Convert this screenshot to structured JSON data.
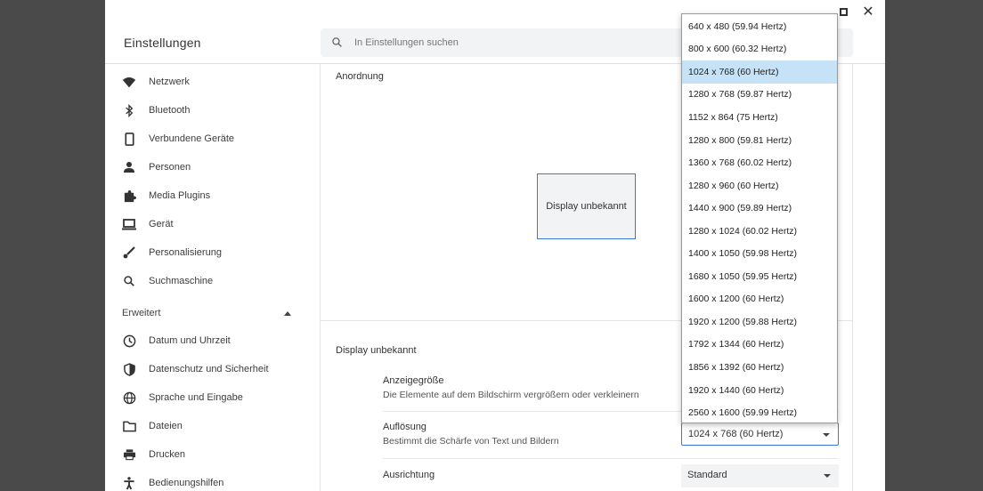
{
  "app": {
    "title": "Einstellungen"
  },
  "search": {
    "placeholder": "In Einstellungen suchen"
  },
  "sidebar": {
    "items": [
      {
        "label": "Netzwerk",
        "icon": "wifi-icon"
      },
      {
        "label": "Bluetooth",
        "icon": "bluetooth-icon"
      },
      {
        "label": "Verbundene Geräte",
        "icon": "phone-icon"
      },
      {
        "label": "Personen",
        "icon": "person-icon"
      },
      {
        "label": "Media Plugins",
        "icon": "puzzle-icon"
      },
      {
        "label": "Gerät",
        "icon": "laptop-icon"
      },
      {
        "label": "Personalisierung",
        "icon": "brush-icon"
      },
      {
        "label": "Suchmaschine",
        "icon": "search-icon"
      }
    ],
    "advanced_label": "Erweitert",
    "advanced_items": [
      {
        "label": "Datum und Uhrzeit",
        "icon": "clock-icon"
      },
      {
        "label": "Datenschutz und Sicherheit",
        "icon": "shield-icon"
      },
      {
        "label": "Sprache und Eingabe",
        "icon": "globe-icon"
      },
      {
        "label": "Dateien",
        "icon": "folder-icon"
      },
      {
        "label": "Drucken",
        "icon": "printer-icon"
      },
      {
        "label": "Bedienungshilfen",
        "icon": "accessibility-icon"
      }
    ]
  },
  "main": {
    "arrangement_title": "Anordnung",
    "display_box_label": "Display unbekannt",
    "display_section_title": "Display unbekannt",
    "settings": [
      {
        "title": "Anzeigegröße",
        "desc": "Die Elemente auf dem Bildschirm vergrößern oder verkleinern"
      },
      {
        "title": "Auflösung",
        "desc": "Bestimmt die Schärfe von Text und Bildern"
      },
      {
        "title": "Ausrichtung",
        "desc": ""
      }
    ],
    "resolution_value": "1024 x 768 (60 Hertz)",
    "orientation_value": "Standard"
  },
  "dropdown": {
    "selected_index": 2,
    "options": [
      "640 x 480 (59.94 Hertz)",
      "800 x 600 (60.32 Hertz)",
      "1024 x 768 (60 Hertz)",
      "1280 x 768 (59.87 Hertz)",
      "1152 x 864 (75 Hertz)",
      "1280 x 800 (59.81 Hertz)",
      "1360 x 768 (60.02 Hertz)",
      "1280 x 960 (60 Hertz)",
      "1440 x 900 (59.89 Hertz)",
      "1280 x 1024 (60.02 Hertz)",
      "1400 x 1050 (59.98 Hertz)",
      "1680 x 1050 (59.95 Hertz)",
      "1600 x 1200 (60 Hertz)",
      "1920 x 1200 (59.88 Hertz)",
      "1792 x 1344 (60 Hertz)",
      "1856 x 1392 (60 Hertz)",
      "1920 x 1440 (60 Hertz)",
      "2560 x 1600 (59.99 Hertz)"
    ]
  }
}
